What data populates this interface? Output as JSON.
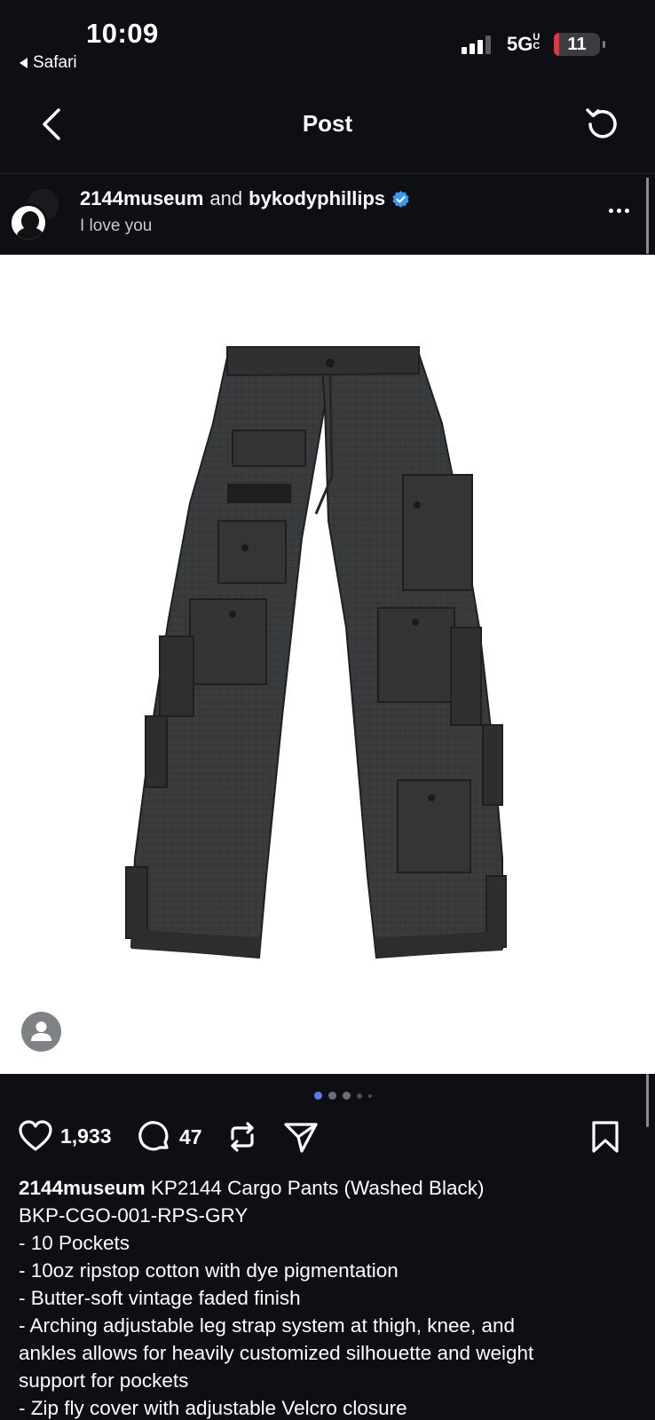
{
  "status_bar": {
    "time": "10:09",
    "back_app": "Safari",
    "network": "5G",
    "network_suffix": "UC",
    "battery": "11",
    "battery_color": "#e0383e"
  },
  "nav": {
    "title": "Post",
    "back_icon": "chevron-left",
    "refresh_icon": "refresh"
  },
  "post": {
    "author": "2144museum",
    "and_text": "and",
    "coauthor": "bykodyphillips",
    "verified": true,
    "subtitle": "I love you",
    "carousel": {
      "total": 5,
      "current": 1,
      "accent": "#5b7cf5"
    }
  },
  "actions": {
    "likes": "1,933",
    "comments": "47"
  },
  "caption": {
    "username": "2144museum",
    "lines": [
      "KP2144 Cargo Pants (Washed Black)",
      "BKP-CGO-001-RPS-GRY",
      "- 10 Pockets",
      "- 10oz ripstop cotton with dye pigmentation",
      "- Butter-soft vintage faded finish",
      "- Arching adjustable leg strap system at thigh, knee, and",
      "ankles allows for heavily customized silhouette and weight",
      "support for pockets",
      "- Zip fly cover with adjustable Velcro closure"
    ]
  }
}
